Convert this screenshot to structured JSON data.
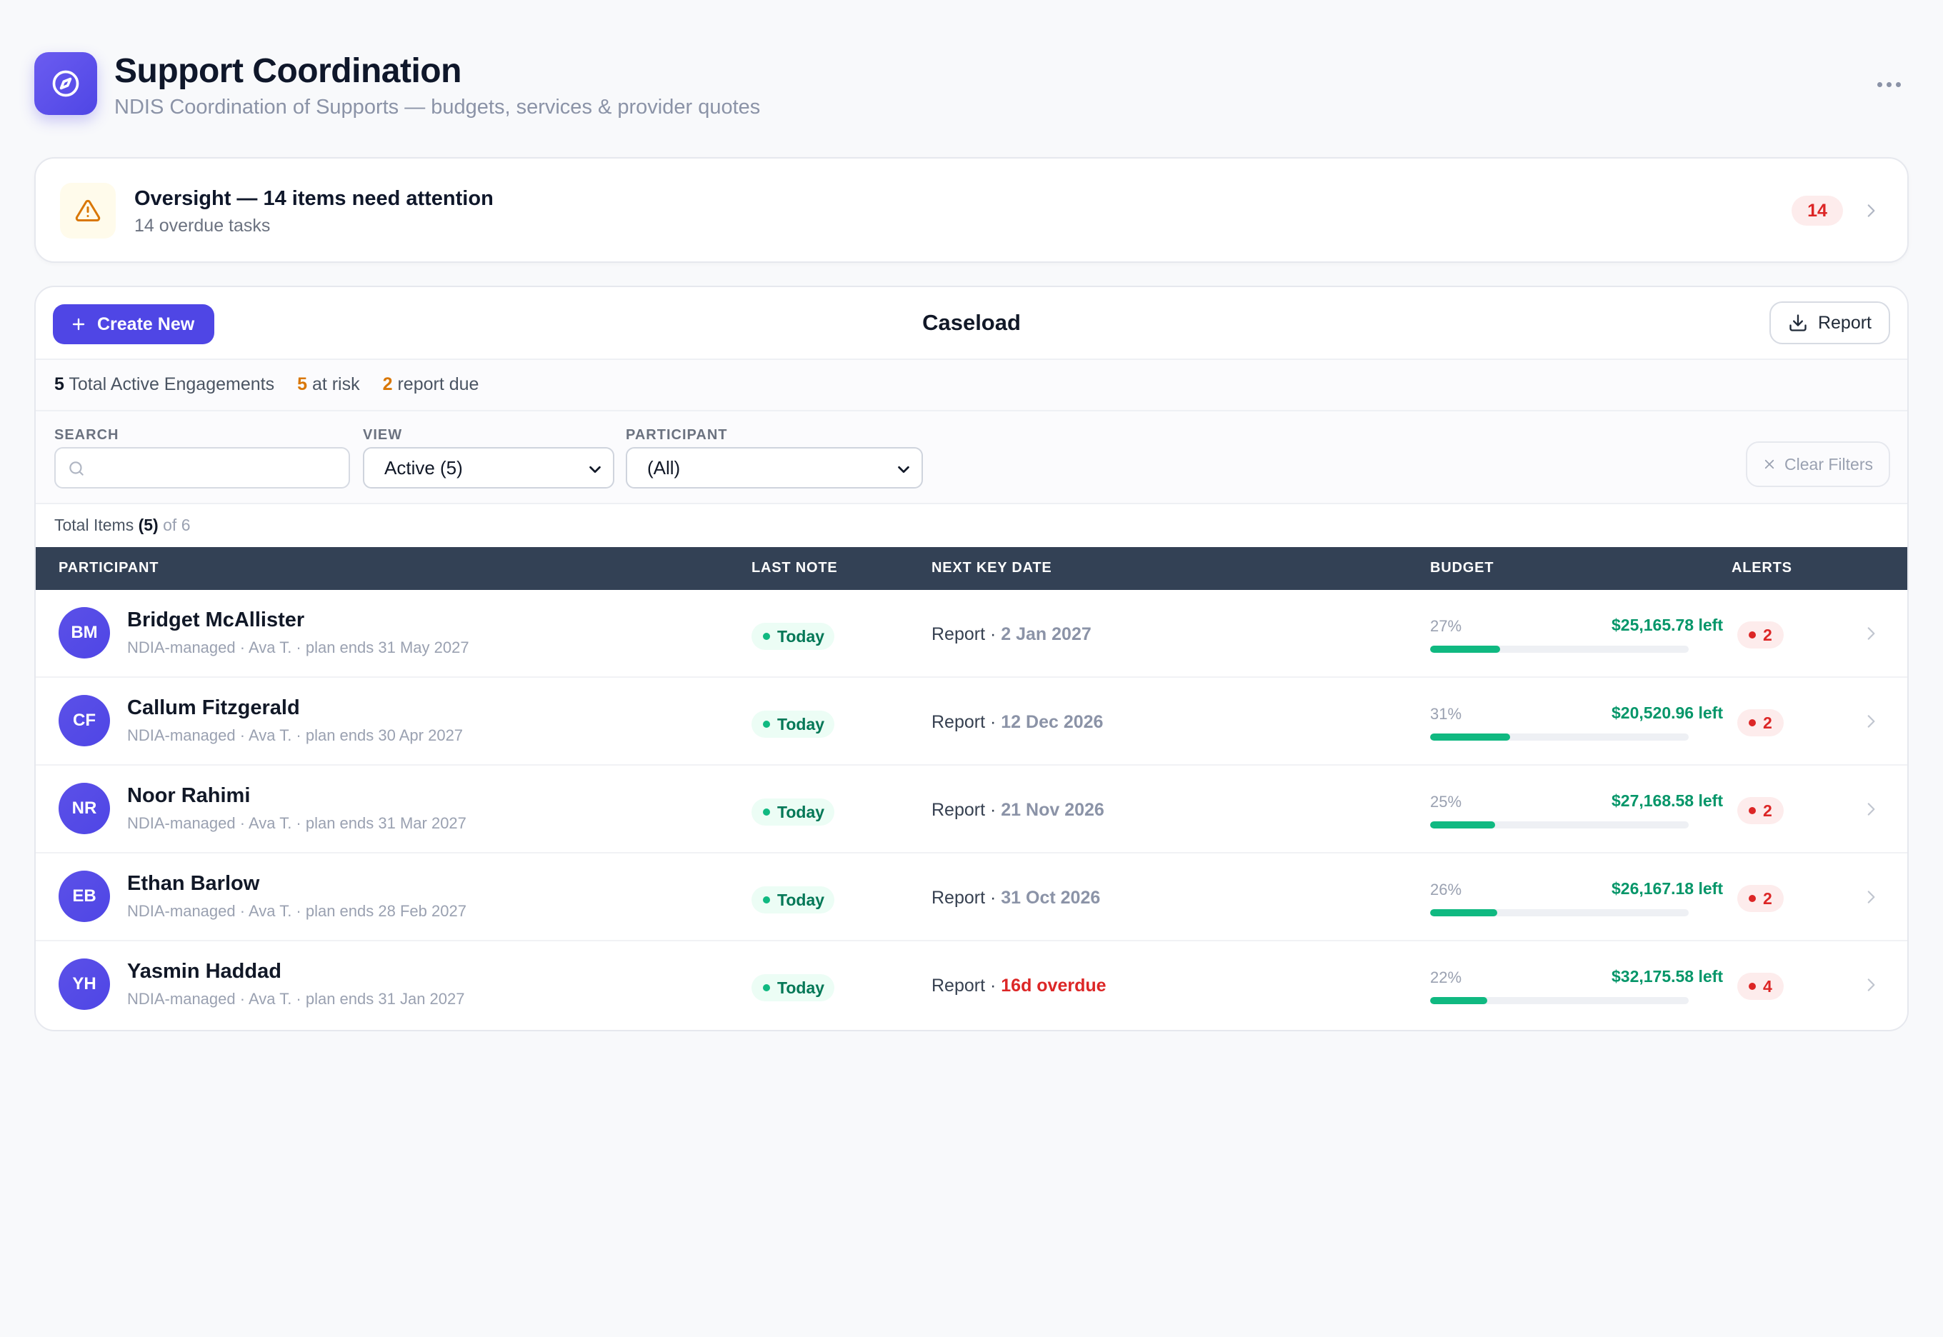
{
  "header": {
    "title": "Support Coordination",
    "subtitle": "NDIS Coordination of Supports — budgets, services & provider quotes",
    "app_icon": "compass-icon",
    "more_icon": "more-horizontal-icon"
  },
  "oversight": {
    "title": "Oversight — 14 items need attention",
    "subtitle": "14 overdue tasks",
    "badge": "14",
    "icon": "warning-triangle-icon"
  },
  "toolbar": {
    "create_label": "Create New",
    "title": "Caseload",
    "report_label": "Report"
  },
  "stats": {
    "active_count": "5",
    "active_label": "Total Active Engagements",
    "risk_count": "5",
    "risk_label": "at risk",
    "due_count": "2",
    "due_label": "report due"
  },
  "filters": {
    "search_label": "SEARCH",
    "search_value": "",
    "search_placeholder": "",
    "view_label": "VIEW",
    "view_value": "Active (5)",
    "participant_label": "PARTICIPANT",
    "participant_value": "(All)",
    "clear_label": "Clear Filters"
  },
  "totals": {
    "label": "Total Items",
    "count": "(5)",
    "of": "of 6"
  },
  "table": {
    "columns": {
      "participant": "PARTICIPANT",
      "last_note": "LAST NOTE",
      "next_key_date": "NEXT KEY DATE",
      "budget": "BUDGET",
      "alerts": "ALERTS"
    },
    "rows": [
      {
        "initials": "BM",
        "name": "Bridget McAllister",
        "sub": "NDIA-managed · Ava T. · plan ends 31 May 2027",
        "last_note": "Today",
        "key_prefix": "Report · ",
        "key_date": "2 Jan 2027",
        "overdue": false,
        "budget_pct": "27%",
        "budget_fraction": 0.27,
        "budget_left": "$25,165.78 left",
        "alerts": "2"
      },
      {
        "initials": "CF",
        "name": "Callum Fitzgerald",
        "sub": "NDIA-managed · Ava T. · plan ends 30 Apr 2027",
        "last_note": "Today",
        "key_prefix": "Report · ",
        "key_date": "12 Dec 2026",
        "overdue": false,
        "budget_pct": "31%",
        "budget_fraction": 0.31,
        "budget_left": "$20,520.96 left",
        "alerts": "2"
      },
      {
        "initials": "NR",
        "name": "Noor Rahimi",
        "sub": "NDIA-managed · Ava T. · plan ends 31 Mar 2027",
        "last_note": "Today",
        "key_prefix": "Report · ",
        "key_date": "21 Nov 2026",
        "overdue": false,
        "budget_pct": "25%",
        "budget_fraction": 0.25,
        "budget_left": "$27,168.58 left",
        "alerts": "2"
      },
      {
        "initials": "EB",
        "name": "Ethan Barlow",
        "sub": "NDIA-managed · Ava T. · plan ends 28 Feb 2027",
        "last_note": "Today",
        "key_prefix": "Report · ",
        "key_date": "31 Oct 2026",
        "overdue": false,
        "budget_pct": "26%",
        "budget_fraction": 0.26,
        "budget_left": "$26,167.18 left",
        "alerts": "2"
      },
      {
        "initials": "YH",
        "name": "Yasmin Haddad",
        "sub": "NDIA-managed · Ava T. · plan ends 31 Jan 2027",
        "last_note": "Today",
        "key_prefix": "Report · ",
        "key_date": "16d overdue",
        "overdue": true,
        "budget_pct": "22%",
        "budget_fraction": 0.22,
        "budget_left": "$32,175.58 left",
        "alerts": "4"
      }
    ]
  },
  "colors": {
    "accent": "#4f46e5",
    "header_row": "#334155",
    "success": "#10b981",
    "danger": "#dc2626",
    "warning": "#d97706"
  }
}
